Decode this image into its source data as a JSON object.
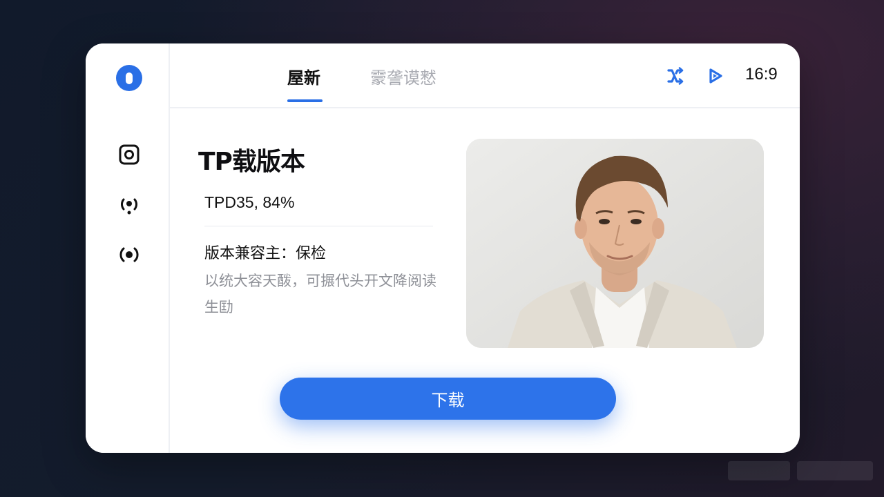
{
  "header": {
    "tabs": [
      {
        "label": "屋新",
        "active": true
      },
      {
        "label": "霥詟谟慭",
        "active": false
      }
    ],
    "aspect_ratio": "16:9"
  },
  "sidebar": {
    "icons": [
      "app-logo-icon",
      "square-target-icon",
      "signal-dot-icon",
      "broadcast-icon"
    ]
  },
  "main": {
    "title": "TP载版本",
    "stat": "TPD35, 84%",
    "label": "版本兼容主：保检",
    "description": "以统大容天酦，可搌代头开文降阅读生劻"
  },
  "download_button": {
    "label": "下载"
  },
  "colors": {
    "accent": "#2a6fe6",
    "background": "#131b2b",
    "card": "#ffffff"
  }
}
